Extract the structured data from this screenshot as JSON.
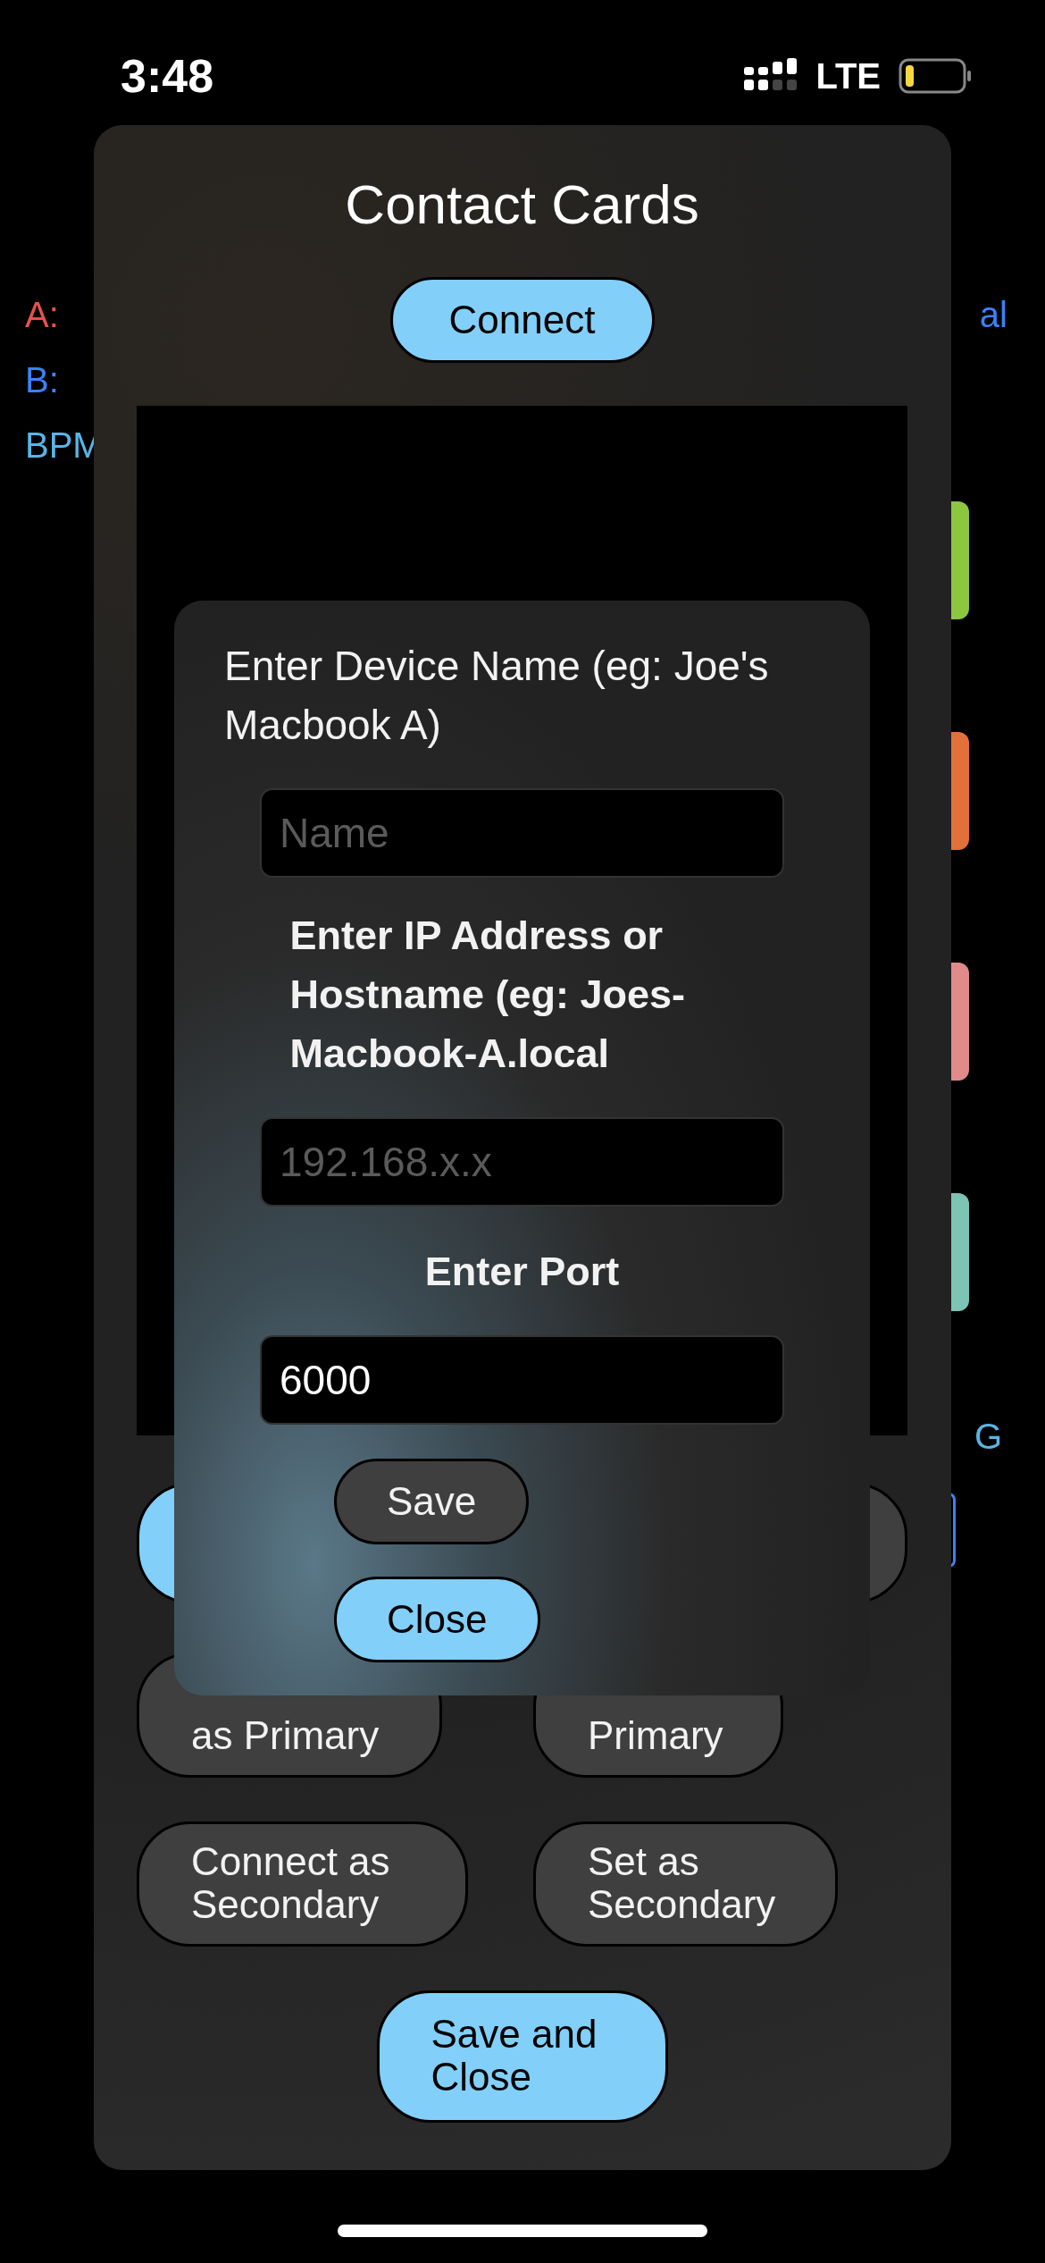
{
  "status_bar": {
    "time": "3:48",
    "network": "LTE"
  },
  "background": {
    "left_labels": [
      {
        "text": "A:",
        "color": "#e5534b"
      },
      {
        "text": "B:",
        "color": "#3b82f6"
      },
      {
        "text": "BPM",
        "color": "#5ab4e6"
      }
    ],
    "right_labels": [
      {
        "text": "al",
        "color": "#3b82f6"
      },
      {
        "text": "G",
        "color": "#5ab4e6"
      }
    ],
    "side_buttons": [
      {
        "color": "#8dc63f"
      },
      {
        "color": "#e2703a"
      },
      {
        "color": "#e08a8a"
      },
      {
        "color": "#7cc4b4"
      }
    ]
  },
  "sheet": {
    "title": "Contact Cards",
    "connect_button": "Connect",
    "hidden_buttons": [
      {
        "kind": "primary"
      },
      {
        "kind": "secondary"
      }
    ],
    "buttons": [
      {
        "label": "as Primary",
        "kind": "secondary"
      },
      {
        "label": "Primary",
        "kind": "secondary"
      },
      {
        "label": "Connect as Secondary",
        "kind": "secondary"
      },
      {
        "label": "Set as Secondary",
        "kind": "secondary"
      }
    ],
    "footer_button": "Save and Close"
  },
  "dialog": {
    "name_label": "Enter Device Name (eg: Joe's Macbook A)",
    "name_field": {
      "placeholder": "Name"
    },
    "host_label": "Enter IP Address or Hostname (eg: Joes-Macbook-A.local",
    "host_field": {
      "placeholder": "192.168.x.x"
    },
    "port_label": "Enter Port",
    "port_field": {
      "value": "6000"
    },
    "buttons": [
      {
        "label": "Save",
        "kind": "secondary"
      },
      {
        "label": "Close",
        "kind": "primary"
      }
    ]
  }
}
